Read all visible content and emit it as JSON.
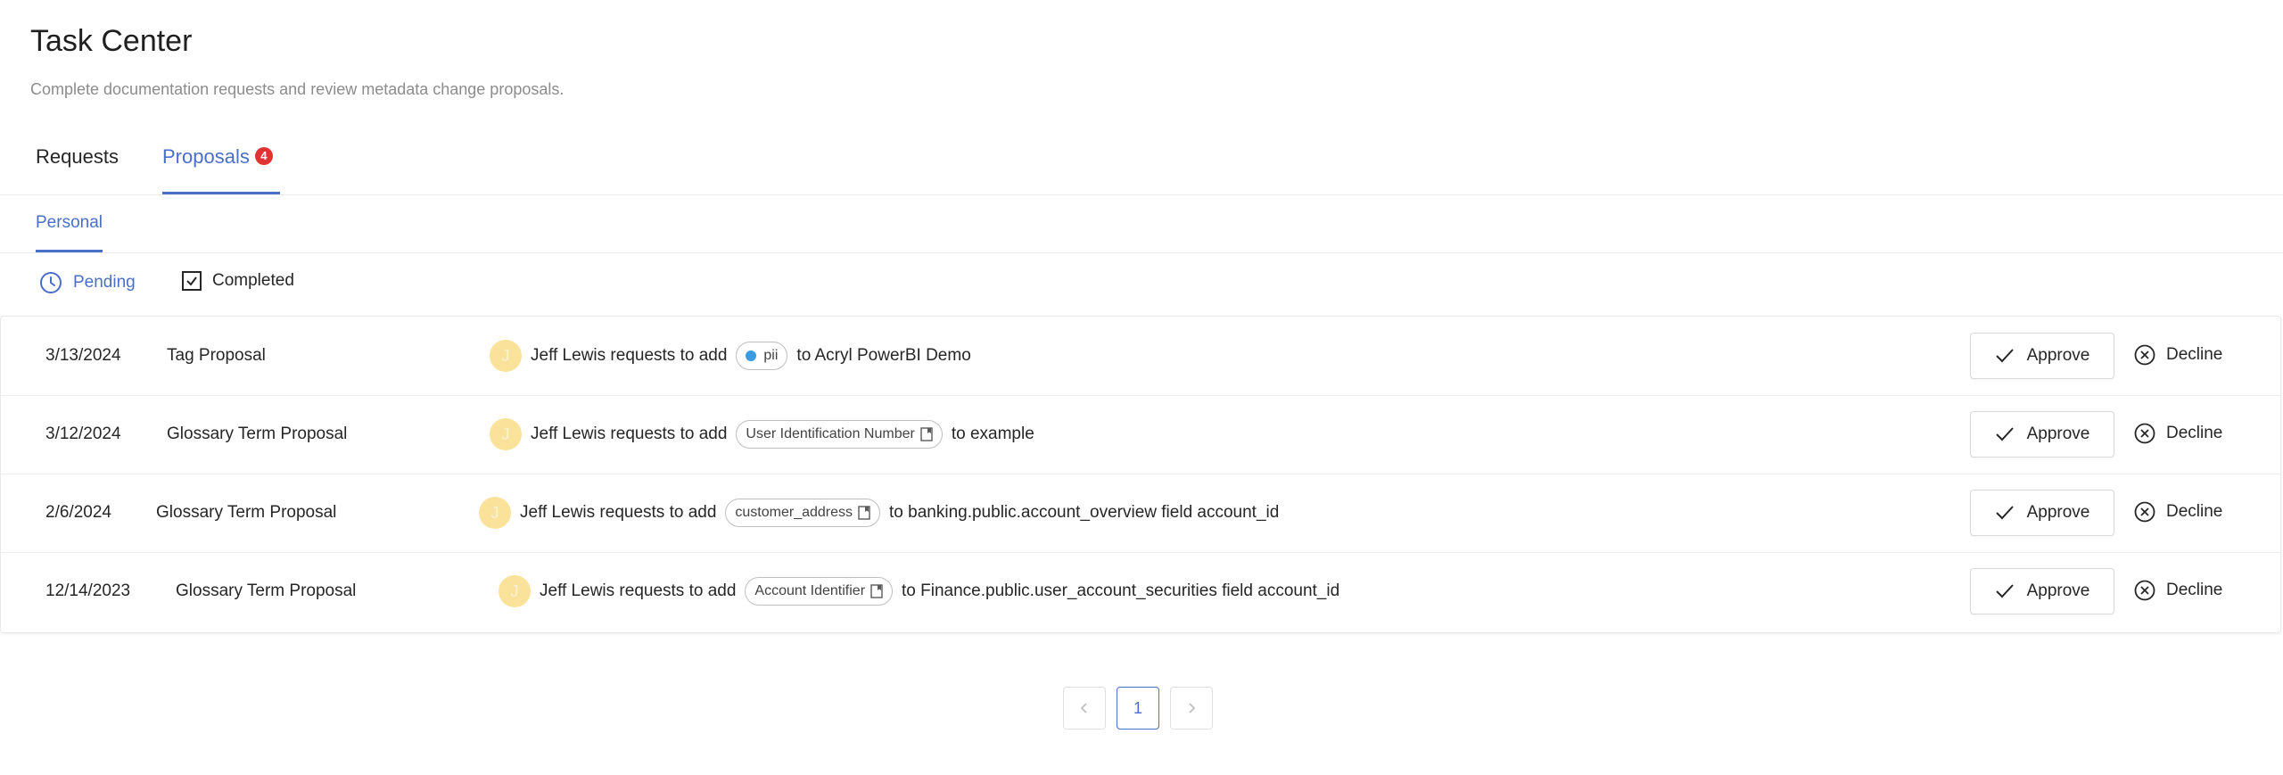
{
  "page": {
    "title": "Task Center",
    "subtitle": "Complete documentation requests and review metadata change proposals."
  },
  "tabs": [
    {
      "label": "Requests",
      "active": false
    },
    {
      "label": "Proposals",
      "badge": "4",
      "active": true
    }
  ],
  "subtabs": [
    {
      "label": "Personal",
      "active": true
    }
  ],
  "filters": [
    {
      "label": "Pending",
      "icon": "clock-icon",
      "active": true
    },
    {
      "label": "Completed",
      "icon": "checkbox-icon",
      "active": false
    }
  ],
  "rows": [
    {
      "date": "3/13/2024",
      "type": "Tag Proposal",
      "avatar": "J",
      "user": "Jeff Lewis",
      "action": "requests to add",
      "chip": "pii",
      "chip_kind": "tag",
      "target": "to Acryl PowerBI Demo"
    },
    {
      "date": "3/12/2024",
      "type": "Glossary Term Proposal",
      "avatar": "J",
      "user": "Jeff Lewis",
      "action": "requests to add",
      "chip": "User Identification Number",
      "chip_kind": "term",
      "target": "to example"
    },
    {
      "date": "2/6/2024",
      "type": "Glossary Term Proposal",
      "avatar": "J",
      "user": "Jeff Lewis",
      "action": "requests to add",
      "chip": "customer_address",
      "chip_kind": "term",
      "target": "to banking.public.account_overview field account_id"
    },
    {
      "date": "12/14/2023",
      "type": "Glossary Term Proposal",
      "avatar": "J",
      "user": "Jeff Lewis",
      "action": "requests to add",
      "chip": "Account Identifier",
      "chip_kind": "term",
      "target": "to Finance.public.user_account_securities field account_id"
    }
  ],
  "actions": {
    "approve": "Approve",
    "decline": "Decline"
  },
  "pagination": {
    "current": "1"
  },
  "colors": {
    "accent": "#4a6fc9",
    "badge": "#e03434",
    "avatar": "#fbe29a",
    "tag_dot": "#3a9be0"
  }
}
